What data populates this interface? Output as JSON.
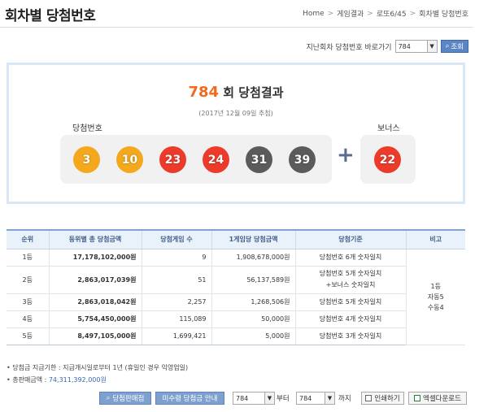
{
  "header": {
    "title": "회차별 당첨번호",
    "breadcrumb": [
      "Home",
      "게임결과",
      "로또6/45",
      "회차별 당첨번호"
    ]
  },
  "prev_search": {
    "label": "지난회차 당첨번호 바로가기",
    "selected": "784",
    "button": "조회"
  },
  "draw": {
    "round": "784",
    "title_suffix": "회 당첨결과",
    "date": "(2017년 12월 09일 추첨)",
    "win_label": "당첨번호",
    "bonus_label": "보너스",
    "numbers": [
      "3",
      "10",
      "23",
      "24",
      "31",
      "39"
    ],
    "bonus": "22",
    "colors": {
      "yellow": "#f4a81d",
      "red": "#ec3b2a",
      "gray": "#5b5b5b",
      "panel": "#f1f1f1",
      "accent": "#f26b1d"
    }
  },
  "table": {
    "headers": [
      "순위",
      "등위별 총 당첨금액",
      "당첨게임 수",
      "1게임당 당첨금액",
      "당첨기준",
      "비고"
    ],
    "rows": [
      {
        "rank": "1등",
        "total": "17,178,102,000원",
        "count": "9",
        "per": "1,908,678,000원",
        "criteria": "당첨번호 6개 숫자일치",
        "criteria2": ""
      },
      {
        "rank": "2등",
        "total": "2,863,017,039원",
        "count": "51",
        "per": "56,137,589원",
        "criteria": "당첨번호 5개 숫자일치",
        "criteria2": "+보너스 숫자일치"
      },
      {
        "rank": "3등",
        "total": "2,863,018,042원",
        "count": "2,257",
        "per": "1,268,506원",
        "criteria": "당첨번호 5개 숫자일치",
        "criteria2": ""
      },
      {
        "rank": "4등",
        "total": "5,754,450,000원",
        "count": "115,089",
        "per": "50,000원",
        "criteria": "당첨번호 4개 숫자일치",
        "criteria2": ""
      },
      {
        "rank": "5등",
        "total": "8,497,105,000원",
        "count": "1,699,421",
        "per": "5,000원",
        "criteria": "당첨번호 3개 숫자일치",
        "criteria2": ""
      }
    ],
    "note": [
      "1등",
      "자동5",
      "수동4"
    ]
  },
  "footer": {
    "note1": "• 당첨금 지급기한 : 지급개시일로부터 1년 (휴일인 경우 익영업일)",
    "note2_label": "• 총판매금액 : ",
    "note2_value": "74,311,392,000원"
  },
  "bottom": {
    "btn_store": "당첨판매점",
    "btn_unclaimed": "미수령 당첨금 안내",
    "from_value": "784",
    "from_label": "부터",
    "to_value": "784",
    "to_label": "까지",
    "btn_print": "인쇄하기",
    "btn_excel": "엑셀다운로드"
  }
}
